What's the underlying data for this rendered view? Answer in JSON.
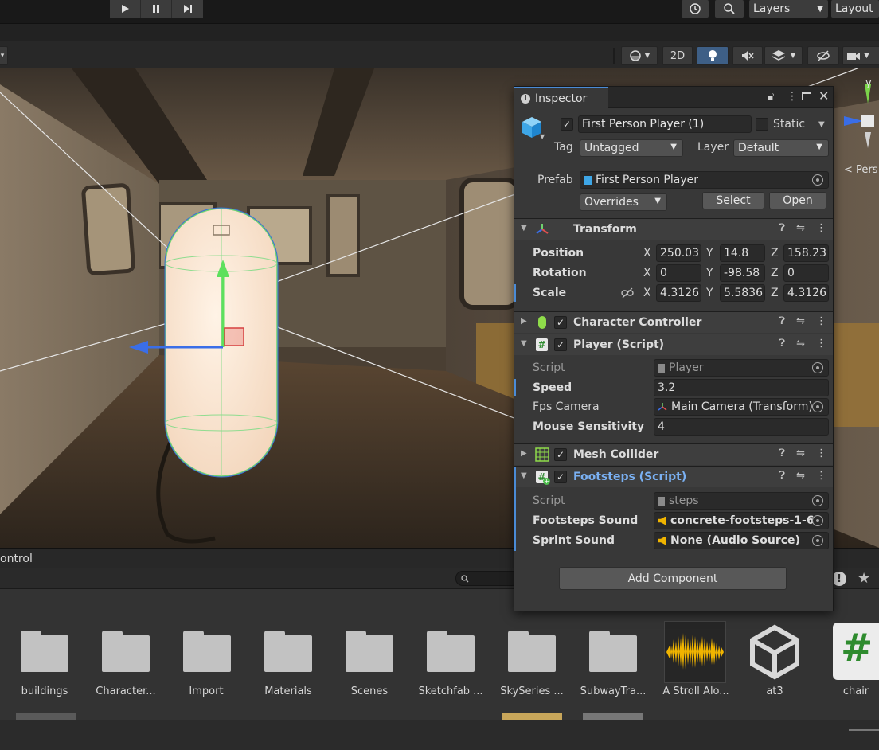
{
  "toolbar": {
    "play_icon": "play-icon",
    "pause_icon": "pause-icon",
    "step_icon": "step-icon",
    "layers_label": "Layers",
    "layout_label": "Layout"
  },
  "scene_toolbar": {
    "mode_2d": "2D"
  },
  "viewport": {
    "gizmo_axis_y": "y",
    "persp_label": "< Pers"
  },
  "inspector": {
    "tab_title": "Inspector",
    "object": {
      "name": "First Person Player (1)",
      "static_label": "Static",
      "tag_label": "Tag",
      "tag_value": "Untagged",
      "layer_label": "Layer",
      "layer_value": "Default",
      "prefab_label": "Prefab",
      "prefab_value": "First Person Player",
      "overrides_label": "Overrides",
      "select_label": "Select",
      "open_label": "Open"
    },
    "transform": {
      "title": "Transform",
      "position_label": "Position",
      "rotation_label": "Rotation",
      "scale_label": "Scale",
      "axis_x": "X",
      "axis_y": "Y",
      "axis_z": "Z",
      "position": [
        "250.03",
        "14.8",
        "158.23"
      ],
      "rotation": [
        "0",
        "-98.58",
        "0"
      ],
      "scale": [
        "4.3126",
        "5.5836",
        "4.3126"
      ]
    },
    "character_controller": {
      "title": "Character Controller"
    },
    "player_script": {
      "title": "Player (Script)",
      "script_label": "Script",
      "script_value": "Player",
      "speed_label": "Speed",
      "speed_value": "3.2",
      "fps_camera_label": "Fps Camera",
      "fps_camera_value": "Main Camera (Transform)",
      "mouse_sensitivity_label": "Mouse Sensitivity",
      "mouse_sensitivity_value": "4"
    },
    "mesh_collider": {
      "title": "Mesh Collider"
    },
    "footsteps_script": {
      "title": "Footsteps (Script)",
      "script_label": "Script",
      "script_value": "steps",
      "footsteps_sound_label": "Footsteps Sound",
      "footsteps_sound_value": "concrete-footsteps-1-6",
      "sprint_sound_label": "Sprint Sound",
      "sprint_sound_value": "None (Audio Source)"
    },
    "add_component_label": "Add Component"
  },
  "console": {
    "tab_label": "ontrol"
  },
  "project": {
    "assets": [
      {
        "label": "buildings",
        "kind": "folder"
      },
      {
        "label": "Character...",
        "kind": "folder"
      },
      {
        "label": "Import",
        "kind": "folder"
      },
      {
        "label": "Materials",
        "kind": "folder"
      },
      {
        "label": "Scenes",
        "kind": "folder"
      },
      {
        "label": "Sketchfab ...",
        "kind": "folder"
      },
      {
        "label": "SkySeries ...",
        "kind": "folder"
      },
      {
        "label": "SubwayTra...",
        "kind": "folder"
      },
      {
        "label": "A Stroll Alo...",
        "kind": "audio"
      },
      {
        "label": "at3",
        "kind": "unity-model"
      },
      {
        "label": "chair",
        "kind": "script"
      }
    ]
  },
  "colors": {
    "accent": "#4a8bd6",
    "footsteps_title": "#7ab0f2",
    "audio_waveform": "#f0b400",
    "script_hash": "#2e8b2e"
  }
}
